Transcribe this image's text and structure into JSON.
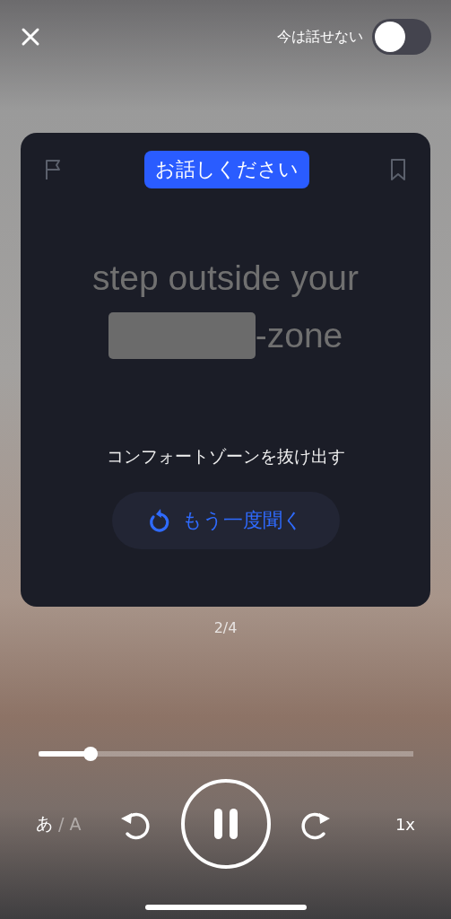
{
  "top_bar": {
    "speak_later": {
      "label": "今は話せない",
      "on": false
    }
  },
  "card": {
    "prompt_badge": "お話しください",
    "flagged": false,
    "bookmarked": false,
    "sentence": [
      {
        "kind": "word",
        "text": "step outside your"
      },
      {
        "kind": "blank"
      },
      {
        "kind": "word",
        "text": "-zone"
      }
    ],
    "translation": "コンフォートゾーンを抜け出す",
    "replay_button": "もう一度聞く"
  },
  "page_counter": "2/4",
  "player": {
    "progress": {
      "level": 0.14
    },
    "script_toggle": {
      "options": [
        {
          "label": "あ",
          "selected": true
        },
        {
          "label": "A",
          "selected": false
        }
      ],
      "separator": "/"
    },
    "playing": true,
    "speed": "1x"
  }
}
